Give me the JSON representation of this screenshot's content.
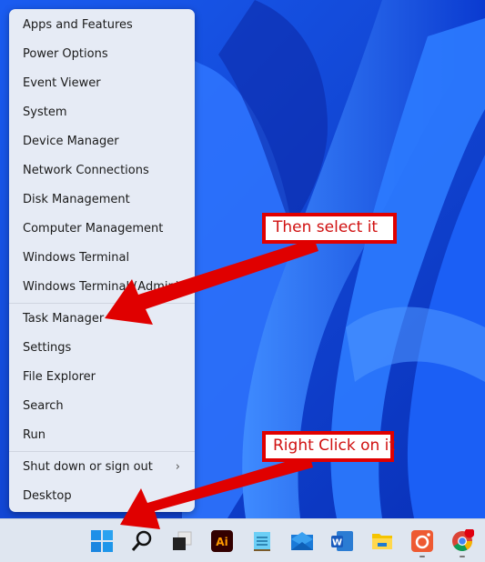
{
  "menu": {
    "items": [
      {
        "label": "Apps and Features"
      },
      {
        "label": "Power Options"
      },
      {
        "label": "Event Viewer"
      },
      {
        "label": "System"
      },
      {
        "label": "Device Manager"
      },
      {
        "label": "Network Connections"
      },
      {
        "label": "Disk Management"
      },
      {
        "label": "Computer Management"
      },
      {
        "label": "Windows Terminal"
      },
      {
        "label": "Windows Terminal (Admin)"
      },
      {
        "label": "Task Manager"
      },
      {
        "label": "Settings"
      },
      {
        "label": "File Explorer"
      },
      {
        "label": "Search"
      },
      {
        "label": "Run"
      },
      {
        "label": "Shut down or sign out",
        "submenu_glyph": "›"
      },
      {
        "label": "Desktop"
      }
    ]
  },
  "annotations": {
    "top_callout": "Then select it",
    "bottom_callout": "Right Click on it",
    "color": "#e00000"
  },
  "taskbar": {
    "icons": [
      {
        "name": "windows-start-icon"
      },
      {
        "name": "search-icon"
      },
      {
        "name": "task-view-icon"
      },
      {
        "name": "adobe-illustrator-icon",
        "text": "Ai"
      },
      {
        "name": "notepad-icon"
      },
      {
        "name": "mail-icon"
      },
      {
        "name": "word-icon",
        "text": "W"
      },
      {
        "name": "file-explorer-icon"
      },
      {
        "name": "screen-recorder-icon"
      },
      {
        "name": "chrome-icon"
      }
    ]
  }
}
